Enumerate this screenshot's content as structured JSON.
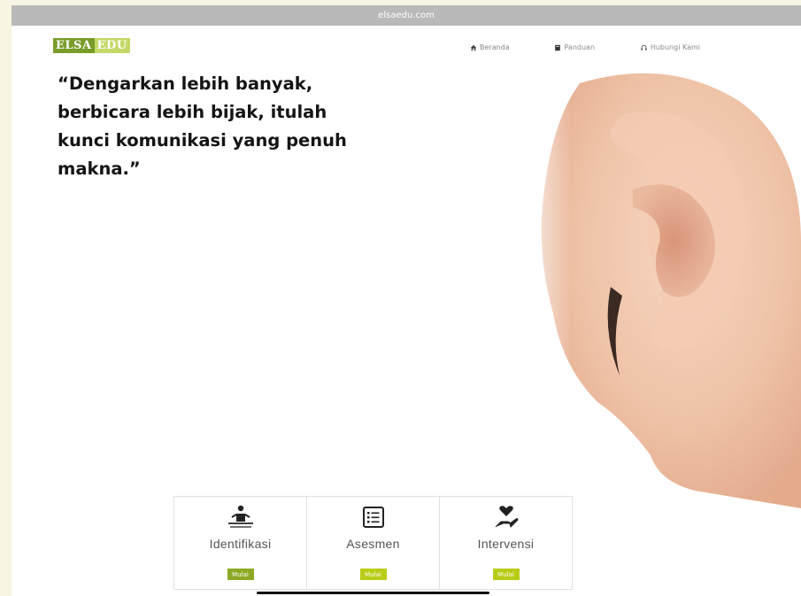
{
  "browser": {
    "url": "elsaedu.com"
  },
  "logo": {
    "part1": "ELSA",
    "part2": "EDU"
  },
  "nav": {
    "items": [
      {
        "label": "Beranda",
        "icon": "home-icon"
      },
      {
        "label": "Panduan",
        "icon": "book-icon"
      },
      {
        "label": "Hubungi Kami",
        "icon": "headset-icon"
      }
    ]
  },
  "hero": {
    "quote_lines": [
      "“Dengarkan lebih banyak,",
      "berbicara lebih bijak, itulah",
      "kunci komunikasi yang penuh",
      "makna.”"
    ]
  },
  "cards": [
    {
      "label": "Identifikasi",
      "button": "Mulai",
      "icon": "identification-icon"
    },
    {
      "label": "Asesmen",
      "button": "Mulai",
      "icon": "checklist-icon"
    },
    {
      "label": "Intervensi",
      "button": "Mulai",
      "icon": "heart-hand-icon"
    }
  ],
  "colors": {
    "accent_green": "#8caa25",
    "accent_lime": "#b9cc16",
    "logo_dark": "#7a9c2a",
    "logo_light": "#c4d96a"
  }
}
